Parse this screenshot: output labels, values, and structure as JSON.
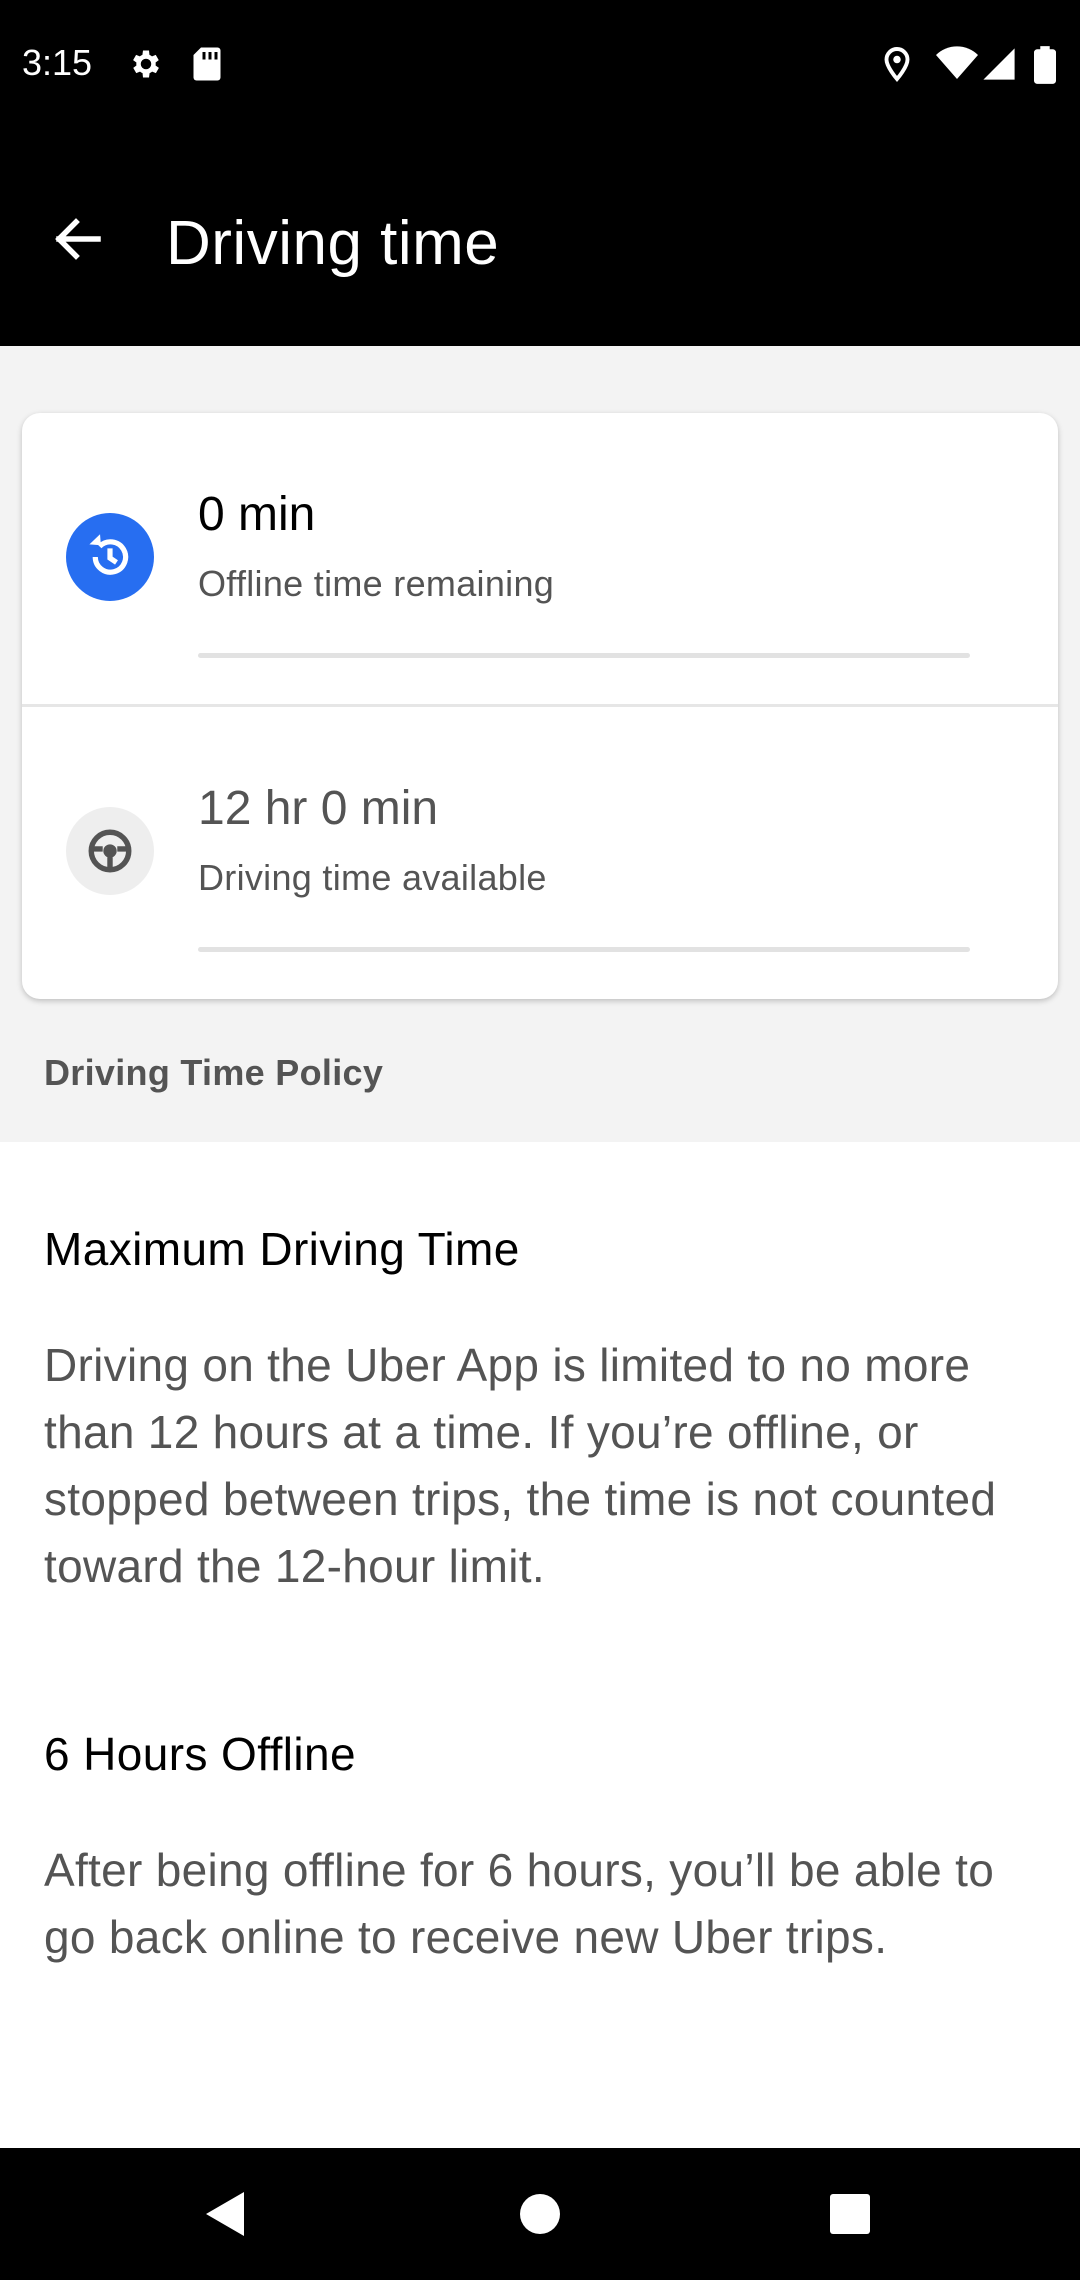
{
  "status_bar": {
    "time": "3:15",
    "icons_left": [
      "gear-icon",
      "sd-card-icon"
    ],
    "icons_right": [
      "location-icon",
      "wifi-icon",
      "signal-icon",
      "battery-icon"
    ]
  },
  "app_bar": {
    "title": "Driving time",
    "back_icon": "arrow-left-icon"
  },
  "card": {
    "offline": {
      "icon": "history-icon",
      "value": "0 min",
      "label": "Offline time remaining",
      "progress_percent": 0,
      "icon_color": "#276EF1"
    },
    "driving": {
      "icon": "steering-wheel-icon",
      "value": "12 hr 0 min",
      "label": "Driving time available",
      "progress_percent": 0
    }
  },
  "section_header": "Driving Time Policy",
  "policy": {
    "max_driving": {
      "heading": "Maximum Driving Time",
      "body": "Driving on the Uber App is limited to no more than 12 hours at a time. If you’re offline, or stopped between trips, the time is not counted toward the 12-hour limit."
    },
    "offline": {
      "heading": "6 Hours Offline",
      "body": "After being offline for 6 hours, you’ll be able to go back online to receive new Uber trips."
    }
  },
  "nav_bar": {
    "icons": [
      "back-triangle-icon",
      "home-circle-icon",
      "recents-square-icon"
    ]
  }
}
